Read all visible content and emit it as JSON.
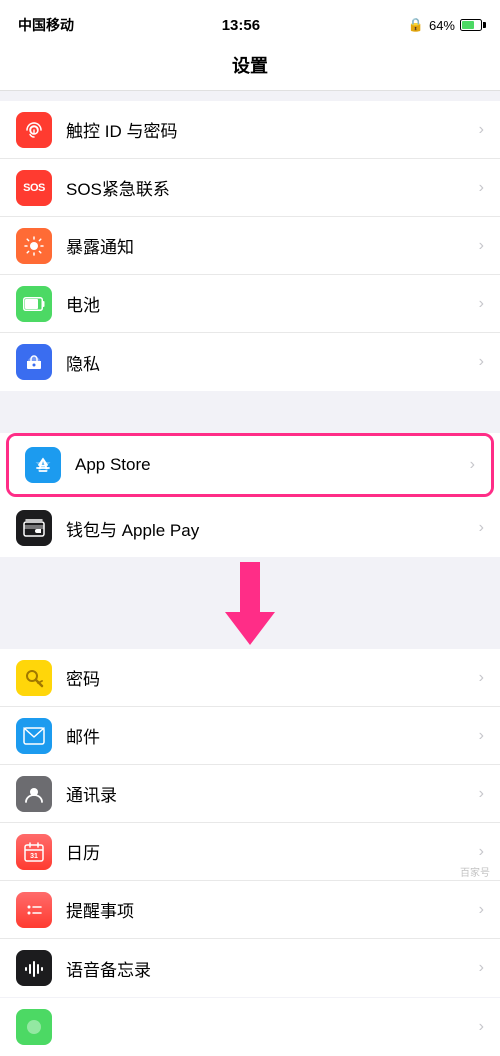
{
  "statusBar": {
    "carrier": "中国移动",
    "time": "13:56",
    "batteryPercent": "64%",
    "batteryLevel": 0.64
  },
  "navTitle": "设置",
  "groups": [
    {
      "id": "group1",
      "items": [
        {
          "id": "touch-id",
          "label": "触控 ID 与密码",
          "iconType": "touchid",
          "iconSymbol": "fingerprint"
        },
        {
          "id": "sos",
          "label": "SOS紧急联系",
          "iconType": "sos",
          "iconSymbol": "sos"
        },
        {
          "id": "exposure",
          "label": "暴露通知",
          "iconType": "exposure",
          "iconSymbol": "sun"
        },
        {
          "id": "battery",
          "label": "电池",
          "iconType": "battery",
          "iconSymbol": "battery"
        },
        {
          "id": "privacy",
          "label": "隐私",
          "iconType": "privacy",
          "iconSymbol": "hand"
        }
      ]
    },
    {
      "id": "group2",
      "items": [
        {
          "id": "appstore",
          "label": "App Store",
          "iconType": "appstore",
          "iconSymbol": "appstore",
          "highlighted": true
        },
        {
          "id": "wallet",
          "label": "钱包与 Apple Pay",
          "iconType": "wallet",
          "iconSymbol": "wallet"
        }
      ]
    },
    {
      "id": "group3",
      "items": [
        {
          "id": "passwords",
          "label": "密码",
          "iconType": "passwords",
          "iconSymbol": "key"
        },
        {
          "id": "mail",
          "label": "邮件",
          "iconType": "mail",
          "iconSymbol": "mail"
        },
        {
          "id": "contacts",
          "label": "通讯录",
          "iconType": "contacts",
          "iconSymbol": "contacts"
        },
        {
          "id": "calendar",
          "label": "日历",
          "iconType": "calendar",
          "iconSymbol": "calendar"
        },
        {
          "id": "reminders",
          "label": "提醒事项",
          "iconType": "reminders",
          "iconSymbol": "reminders"
        },
        {
          "id": "voice",
          "label": "语音备忘录",
          "iconType": "voice",
          "iconSymbol": "voice"
        }
      ]
    }
  ],
  "highlightColor": "#ff2d87",
  "arrowColor": "#ff2d87"
}
